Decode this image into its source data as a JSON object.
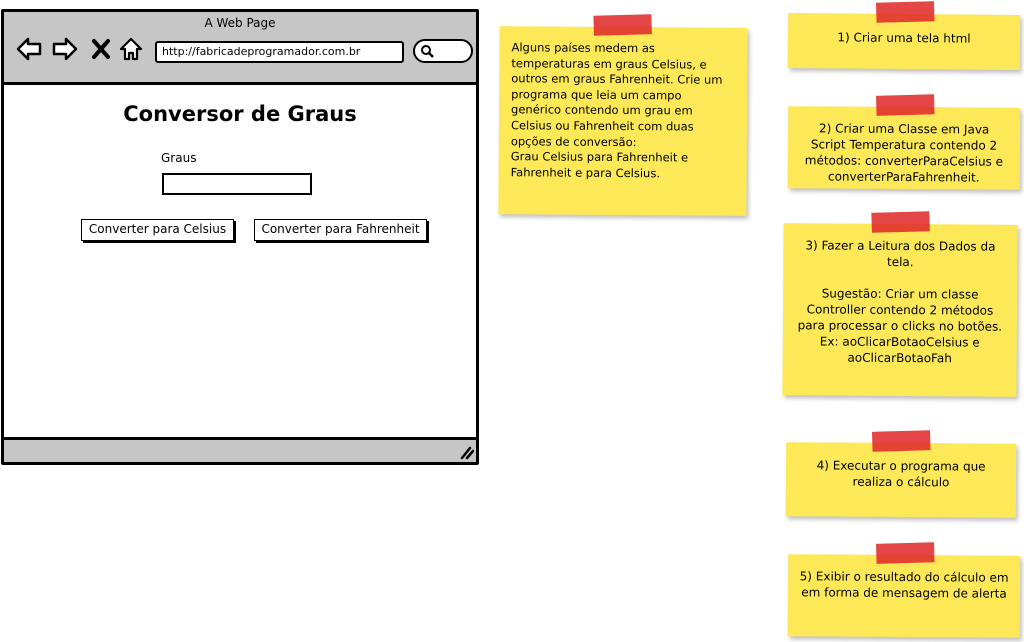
{
  "browser": {
    "title": "A Web Page",
    "url": "http://fabricadeprogramador.com.br",
    "nav_icons": [
      "back-arrow-icon",
      "forward-arrow-icon",
      "close-x-icon",
      "home-icon"
    ],
    "search_icon": "magnifier-icon"
  },
  "page": {
    "heading": "Conversor de Graus",
    "field_label": "Graus",
    "field_value": "",
    "button_celsius": "Converter para Celsius",
    "button_fahrenheit": "Converter para Fahrenheit"
  },
  "notes": {
    "description": "Alguns países medem as\ntemperaturas em graus Celsius, e\noutros em graus Fahrenheit. Crie um\nprograma que leia um campo\ngenérico contendo um grau em\nCelsius ou Fahrenheit com duas\nopções de conversão:\nGrau Celsius para Fahrenheit e\nFahrenheit e para Celsius.",
    "step1": "1) Criar uma tela html",
    "step2": "2) Criar uma Classe em Java\nScript Temperatura contendo 2\nmétodos: converterParaCelsius e\nconverterParaFahrenheit.",
    "step3": "3) Fazer a Leitura dos Dados da\ntela.\n\nSugestão: Criar um classe\nController contendo 2 métodos\npara processar o clicks no botões.\nEx: aoClicarBotaoCelsius e\naoClicarBotaoFah",
    "step4": "4) Executar o programa que\nrealiza o cálculo",
    "step5": "5) Exibir o resultado do cálculo em\nem forma de mensagem de alerta"
  },
  "colors": {
    "note_yellow": "#fde957",
    "tape_red": "#e02b2b",
    "chrome_gray": "#c6c6c6"
  }
}
